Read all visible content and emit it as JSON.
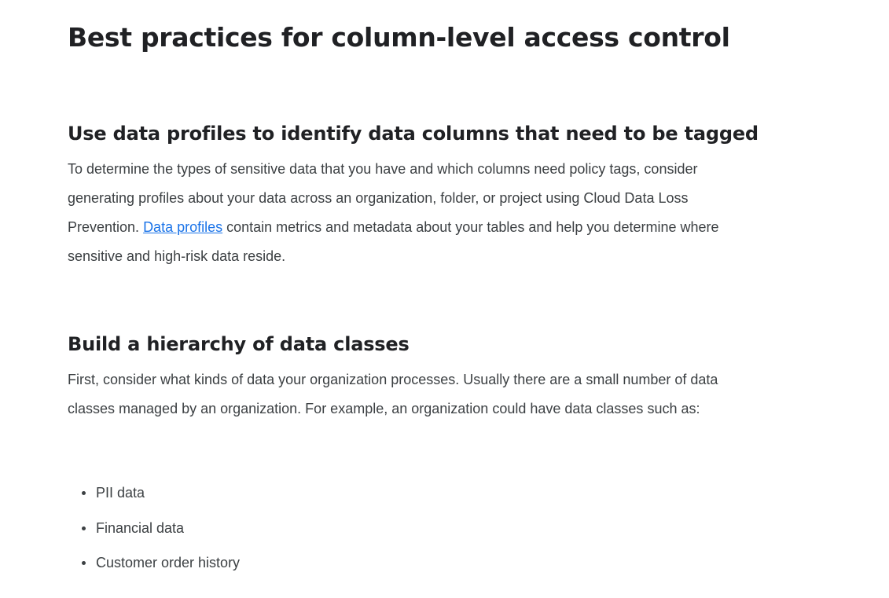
{
  "page": {
    "title": "Best practices for column-level access control"
  },
  "sections": [
    {
      "heading": "Use data profiles to identify data columns that need to be tagged",
      "paragraph": {
        "before_link": "To determine the types of sensitive data that you have and which columns need policy tags, consider generating profiles about your data across an organization, folder, or project using Cloud Data Loss Prevention. ",
        "link_text": "Data profiles",
        "after_link": " contain metrics and metadata about your tables and help you determine where sensitive and high-risk data reside."
      }
    },
    {
      "heading": "Build a hierarchy of data classes",
      "paragraph": "First, consider what kinds of data your organization processes. Usually there are a small number of data classes managed by an organization. For example, an organization could have data classes such as:",
      "list": [
        "PII data",
        "Financial data",
        "Customer order history"
      ]
    }
  ],
  "colors": {
    "text": "#3c4043",
    "heading": "#202124",
    "link": "#1a73e8"
  }
}
